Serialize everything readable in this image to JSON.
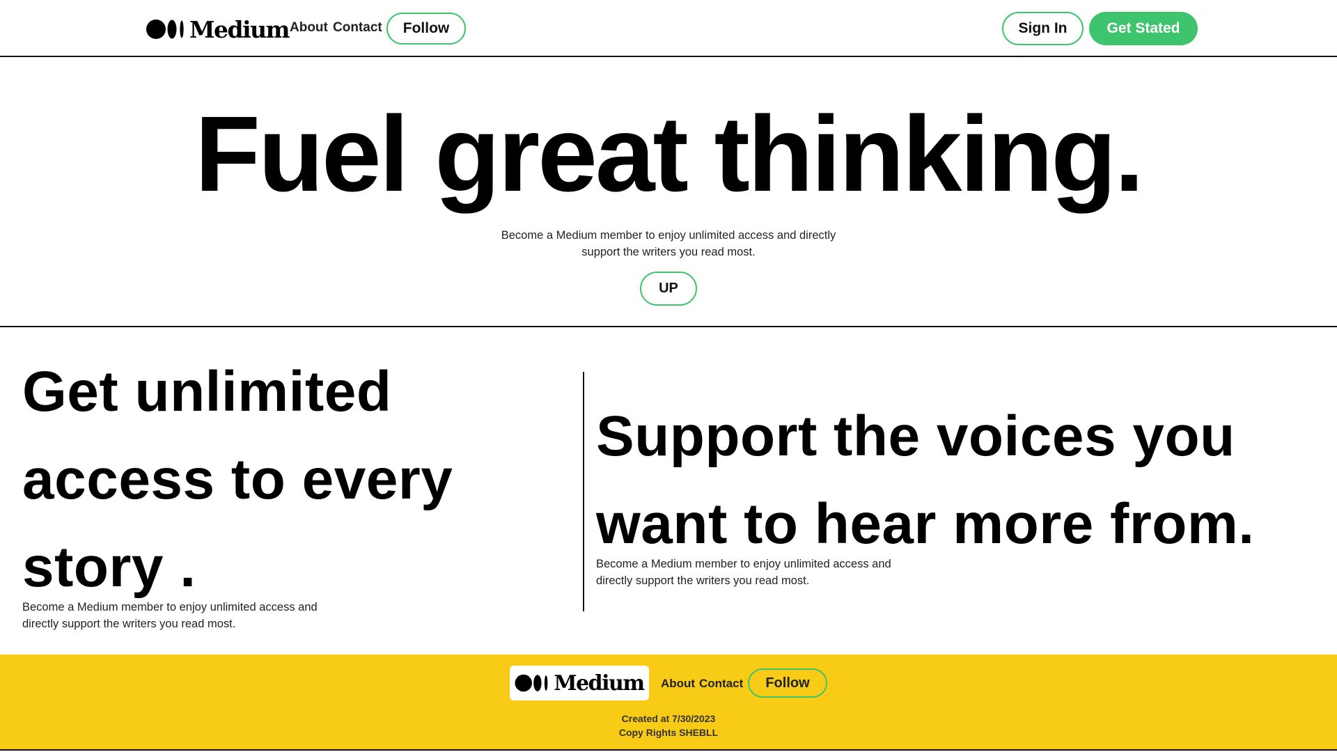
{
  "header": {
    "logo_text": "Medium",
    "nav": {
      "about": "About",
      "contact": "Contact"
    },
    "follow_label": "Follow",
    "sign_in_label": "Sign In",
    "get_started_label": "Get Stated"
  },
  "hero": {
    "title": "Fuel great thinking.",
    "description": "Become a Medium member to enjoy unlimited access and directly support the writers you read most.",
    "button_label": "UP"
  },
  "features": {
    "left": {
      "title": "Get unlimited access to every story .",
      "description": "Become a Medium member to enjoy unlimited access and directly support the writers you read most."
    },
    "right": {
      "title": "Support the voices you want to hear more from.",
      "description": "Become a Medium member to enjoy unlimited access and directly support the writers you read most."
    }
  },
  "footer": {
    "logo_text": "Medium",
    "nav": {
      "about": "About",
      "contact": "Contact"
    },
    "follow_label": "Follow",
    "created": "Created at 7/30/2023",
    "copyright": "Copy Rights SHEBLL"
  },
  "colors": {
    "accent_green": "#3ec46d",
    "footer_yellow": "#f8cb17",
    "text": "#000000"
  },
  "icons": {
    "logo": "medium-logo-icon"
  }
}
